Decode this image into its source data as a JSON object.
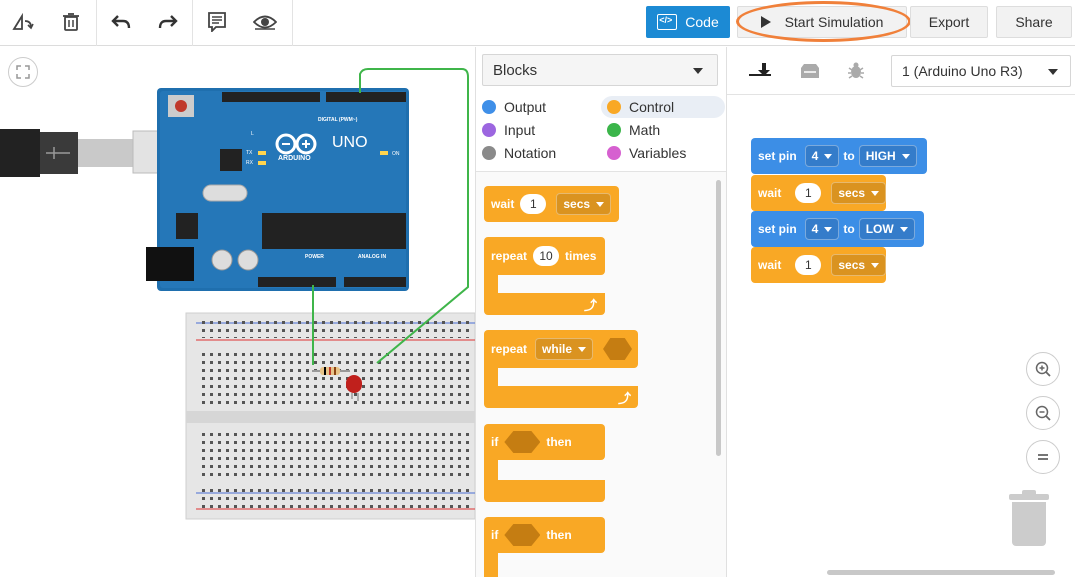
{
  "toolbar": {
    "code_label": "Code",
    "start_simulation_label": "Start Simulation",
    "export_label": "Export",
    "share_label": "Share"
  },
  "blocks_panel": {
    "selected": "Blocks",
    "categories": [
      {
        "label": "Output",
        "color": "#3f8fe8"
      },
      {
        "label": "Control",
        "color": "#f9a825"
      },
      {
        "label": "Input",
        "color": "#9c66e0"
      },
      {
        "label": "Math",
        "color": "#3bb54a"
      },
      {
        "label": "Notation",
        "color": "#8a8a8a"
      },
      {
        "label": "Variables",
        "color": "#d660d0"
      }
    ],
    "blocks": {
      "wait": {
        "label": "wait",
        "value": "1",
        "unit": "secs"
      },
      "repeat_times": {
        "label": "repeat",
        "value": "10",
        "suffix": "times"
      },
      "repeat_while": {
        "label": "repeat",
        "mode": "while"
      },
      "if_then_1": {
        "label": "if",
        "suffix": "then"
      },
      "if_then_2": {
        "label": "if",
        "suffix": "then"
      }
    }
  },
  "code_area": {
    "device": "1 (Arduino Uno R3)",
    "program": [
      {
        "kind": "set-pin",
        "label": "set pin",
        "pin": "4",
        "to": "to",
        "value": "HIGH"
      },
      {
        "kind": "wait",
        "label": "wait",
        "value": "1",
        "unit": "secs"
      },
      {
        "kind": "set-pin",
        "label": "set pin",
        "pin": "4",
        "to": "to",
        "value": "LOW"
      },
      {
        "kind": "wait",
        "label": "wait",
        "value": "1",
        "unit": "secs"
      }
    ]
  },
  "board": {
    "name": "UNO",
    "brand": "ARDUINO",
    "digital_label": "DIGITAL (PWM~)",
    "power_label": "POWER",
    "analog_label": "ANALOG IN",
    "on_label": "ON",
    "tx_label": "TX",
    "rx_label": "RX",
    "l_label": "L"
  }
}
